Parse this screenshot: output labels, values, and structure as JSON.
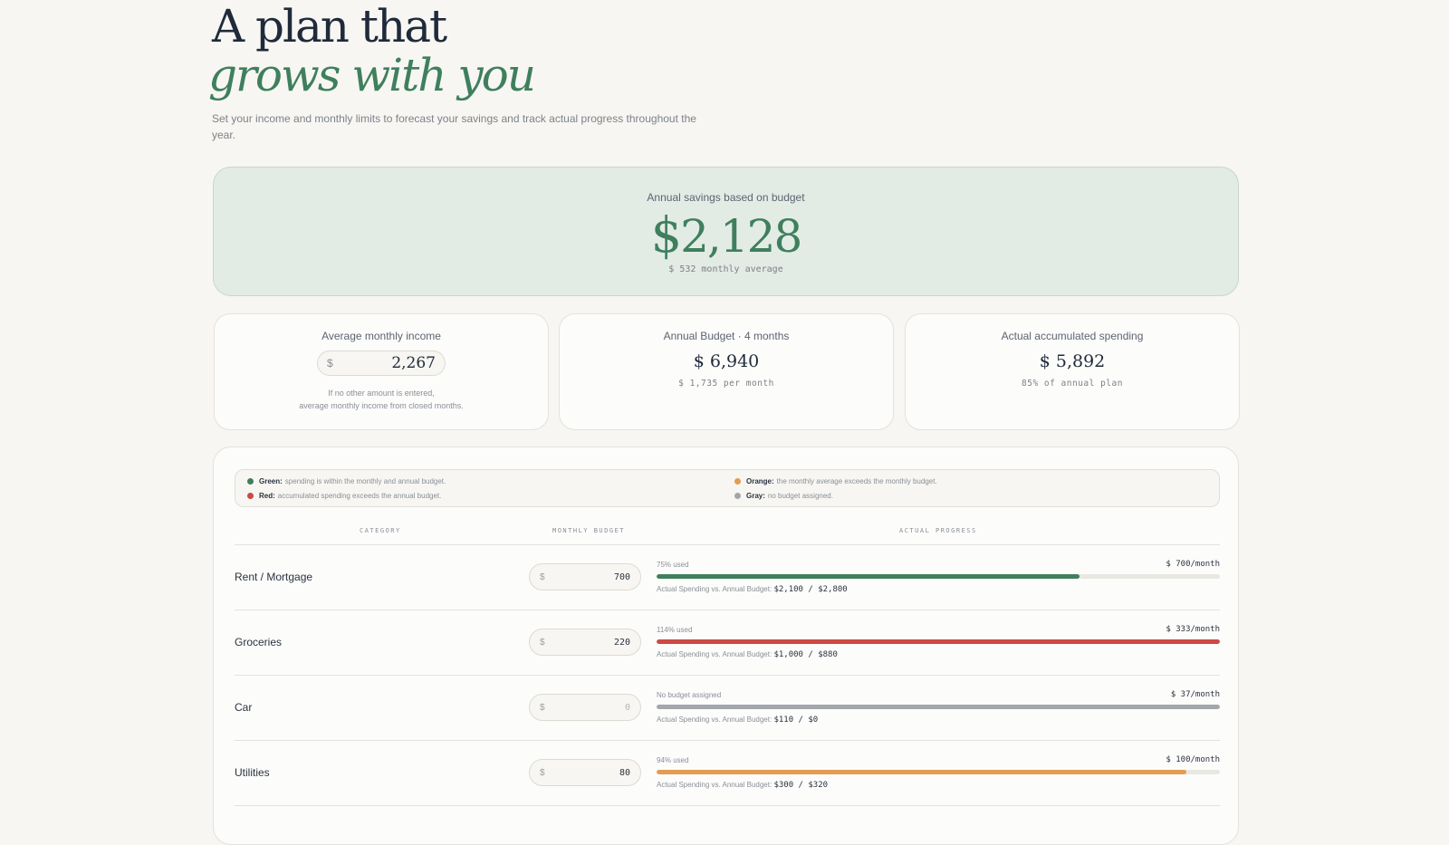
{
  "hero": {
    "line1": "A plan that",
    "line2": "grows with you",
    "subtitle": "Set your income and monthly limits to forecast your savings and track actual progress throughout the year."
  },
  "savings": {
    "label": "Annual savings based on budget",
    "currency": "$",
    "amount": "2,128",
    "monthly": "$ 532 monthly average"
  },
  "income": {
    "label": "Average monthly income",
    "currency": "$",
    "value": "2,267",
    "note_line1": "If no other amount is entered,",
    "note_line2": "average monthly income from closed months."
  },
  "budget": {
    "label": "Annual Budget · 4 months",
    "value": "$ 6,940",
    "sub": "$ 1,735 per month"
  },
  "spending": {
    "label": "Actual accumulated spending",
    "value": "$ 5,892",
    "sub": "85% of annual plan"
  },
  "legend": [
    {
      "label": "Green:",
      "text": "spending is within the monthly and annual budget.",
      "color": "#3f7f5d"
    },
    {
      "label": "Red:",
      "text": "accumulated spending exceeds the annual budget.",
      "color": "#cc4a43"
    },
    {
      "label": "Orange:",
      "text": "the monthly average exceeds the monthly budget.",
      "color": "#e39c52"
    },
    {
      "label": "Gray:",
      "text": "no budget assigned.",
      "color": "#a3a7ab"
    }
  ],
  "columns": {
    "category": "CATEGORY",
    "monthly_budget": "MONTHLY BUDGET",
    "actual_progress": "ACTUAL PROGRESS"
  },
  "rows": [
    {
      "name": "Rent / Mortgage",
      "currency": "$",
      "budget": "700",
      "used": "75% used",
      "monthly": "$  700/month",
      "fill": 0.75,
      "color": "#3f7f5d",
      "compare_label": "Actual Spending vs. Annual Budget:",
      "compare": "$2,100 / $2,800"
    },
    {
      "name": "Groceries",
      "currency": "$",
      "budget": "220",
      "used": "114% used",
      "monthly": "$  333/month",
      "fill": 1.0,
      "color": "#cc4a43",
      "compare_label": "Actual Spending vs. Annual Budget:",
      "compare": "$1,000 / $880"
    },
    {
      "name": "Car",
      "currency": "$",
      "budget": "0",
      "used": "No budget assigned",
      "monthly": "$  37/month",
      "fill": 1.0,
      "color": "#a3a7ab",
      "compare_label": "Actual Spending vs. Annual Budget:",
      "compare": "$110 / $0"
    },
    {
      "name": "Utilities",
      "currency": "$",
      "budget": "80",
      "used": "94% used",
      "monthly": "$  100/month",
      "fill": 0.94,
      "color": "#e39c52",
      "compare_label": "Actual Spending vs. Annual Budget:",
      "compare": "$300 / $320"
    }
  ]
}
